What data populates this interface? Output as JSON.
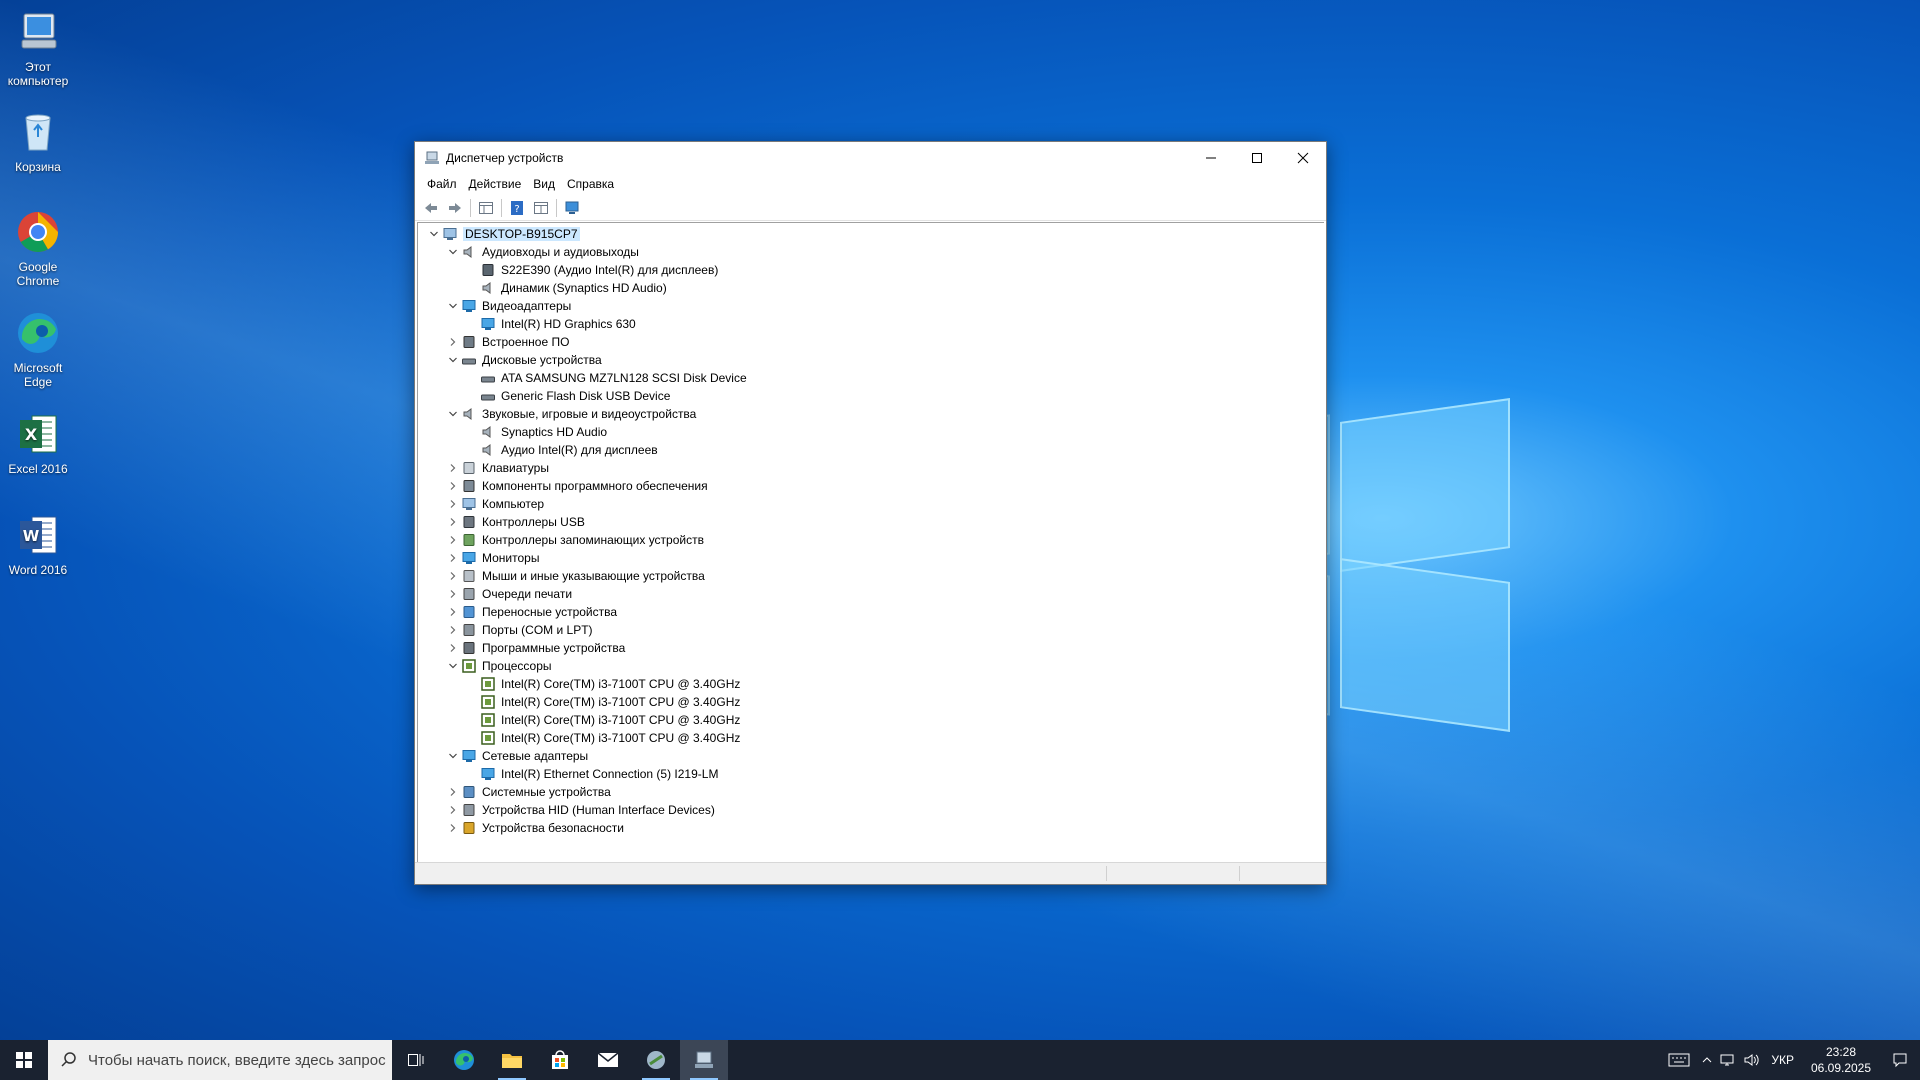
{
  "desktop": {
    "icons": [
      {
        "label": "Этот компьютер"
      },
      {
        "label": "Корзина"
      },
      {
        "label": "Google Chrome"
      },
      {
        "label": "Microsoft Edge"
      },
      {
        "label": "Excel 2016"
      },
      {
        "label": "Word 2016"
      }
    ]
  },
  "window": {
    "title": "Диспетчер устройств",
    "menu": [
      "Файл",
      "Действие",
      "Вид",
      "Справка"
    ],
    "tree": [
      {
        "label": "DESKTOP-B915CP7",
        "level": 0,
        "state": "expanded",
        "icon": "computer-icon"
      },
      {
        "label": "Аудиовходы и аудиовыходы",
        "level": 1,
        "state": "expanded",
        "icon": "speaker-icon"
      },
      {
        "label": "S22E390 (Аудио Intel(R) для дисплеев)",
        "level": 2,
        "state": "none",
        "icon": "monitor-audio-icon"
      },
      {
        "label": "Динамик (Synaptics HD Audio)",
        "level": 2,
        "state": "none",
        "icon": "speaker-icon"
      },
      {
        "label": "Видеоадаптеры",
        "level": 1,
        "state": "expanded",
        "icon": "display-adapter-icon"
      },
      {
        "label": "Intel(R) HD Graphics 630",
        "level": 2,
        "state": "none",
        "icon": "display-adapter-icon"
      },
      {
        "label": "Встроенное ПО",
        "level": 1,
        "state": "collapsed",
        "icon": "firmware-icon"
      },
      {
        "label": "Дисковые устройства",
        "level": 1,
        "state": "expanded",
        "icon": "disk-icon"
      },
      {
        "label": "ATA SAMSUNG MZ7LN128 SCSI Disk Device",
        "level": 2,
        "state": "none",
        "icon": "disk-icon"
      },
      {
        "label": "Generic Flash Disk USB Device",
        "level": 2,
        "state": "none",
        "icon": "disk-icon"
      },
      {
        "label": "Звуковые, игровые и видеоустройства",
        "level": 1,
        "state": "expanded",
        "icon": "speaker-icon"
      },
      {
        "label": "Synaptics HD Audio",
        "level": 2,
        "state": "none",
        "icon": "speaker-icon"
      },
      {
        "label": "Аудио Intel(R) для дисплеев",
        "level": 2,
        "state": "none",
        "icon": "speaker-icon"
      },
      {
        "label": "Клавиатуры",
        "level": 1,
        "state": "collapsed",
        "icon": "keyboard-icon"
      },
      {
        "label": "Компоненты программного обеспечения",
        "level": 1,
        "state": "collapsed",
        "icon": "software-component-icon"
      },
      {
        "label": "Компьютер",
        "level": 1,
        "state": "collapsed",
        "icon": "computer-icon"
      },
      {
        "label": "Контроллеры USB",
        "level": 1,
        "state": "collapsed",
        "icon": "usb-icon"
      },
      {
        "label": "Контроллеры запоминающих устройств",
        "level": 1,
        "state": "collapsed",
        "icon": "storage-controller-icon"
      },
      {
        "label": "Мониторы",
        "level": 1,
        "state": "collapsed",
        "icon": "monitor-icon"
      },
      {
        "label": "Мыши и иные указывающие устройства",
        "level": 1,
        "state": "collapsed",
        "icon": "mouse-icon"
      },
      {
        "label": "Очереди печати",
        "level": 1,
        "state": "collapsed",
        "icon": "printer-icon"
      },
      {
        "label": "Переносные устройства",
        "level": 1,
        "state": "collapsed",
        "icon": "portable-device-icon"
      },
      {
        "label": "Порты (COM и LPT)",
        "level": 1,
        "state": "collapsed",
        "icon": "port-icon"
      },
      {
        "label": "Программные устройства",
        "level": 1,
        "state": "collapsed",
        "icon": "software-device-icon"
      },
      {
        "label": "Процессоры",
        "level": 1,
        "state": "expanded",
        "icon": "processor-icon"
      },
      {
        "label": "Intel(R) Core(TM) i3-7100T CPU @ 3.40GHz",
        "level": 2,
        "state": "none",
        "icon": "processor-icon"
      },
      {
        "label": "Intel(R) Core(TM) i3-7100T CPU @ 3.40GHz",
        "level": 2,
        "state": "none",
        "icon": "processor-icon"
      },
      {
        "label": "Intel(R) Core(TM) i3-7100T CPU @ 3.40GHz",
        "level": 2,
        "state": "none",
        "icon": "processor-icon"
      },
      {
        "label": "Intel(R) Core(TM) i3-7100T CPU @ 3.40GHz",
        "level": 2,
        "state": "none",
        "icon": "processor-icon"
      },
      {
        "label": "Сетевые адаптеры",
        "level": 1,
        "state": "expanded",
        "icon": "network-adapter-icon"
      },
      {
        "label": "Intel(R) Ethernet Connection (5) I219-LM",
        "level": 2,
        "state": "none",
        "icon": "network-adapter-icon"
      },
      {
        "label": "Системные устройства",
        "level": 1,
        "state": "collapsed",
        "icon": "system-device-icon"
      },
      {
        "label": "Устройства HID (Human Interface Devices)",
        "level": 1,
        "state": "collapsed",
        "icon": "hid-icon"
      },
      {
        "label": "Устройства безопасности",
        "level": 1,
        "state": "collapsed",
        "icon": "security-device-icon"
      }
    ]
  },
  "taskbar": {
    "search_placeholder": "Чтобы начать поиск, введите здесь запрос",
    "language": "УКР",
    "time": "23:28",
    "date": "06.09.2025"
  },
  "colors": {
    "selection": "#cce8ff",
    "taskbar": "#1a2230",
    "accent": "#0078d7"
  }
}
